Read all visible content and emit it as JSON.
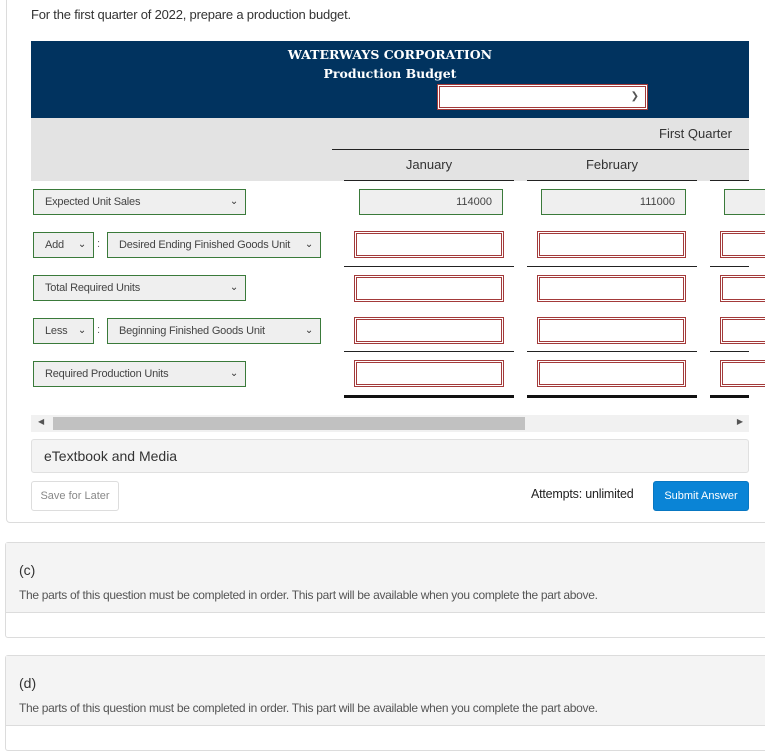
{
  "intro": "For the first quarter of 2022, prepare a production budget.",
  "budget": {
    "company": "WATERWAYS CORPORATION",
    "title": "Production Budget",
    "period_select": {
      "value": ""
    },
    "column_group": "First Quarter",
    "columns": [
      "January",
      "February"
    ]
  },
  "rows": [
    {
      "operator": null,
      "label": "Expected Unit Sales",
      "values": [
        "114000",
        "111000",
        ""
      ]
    },
    {
      "operator": "Add",
      "label": "Desired Ending Finished Goods Unit",
      "values": [
        "",
        "",
        ""
      ]
    },
    {
      "operator": null,
      "label": "Total Required Units",
      "values": [
        "",
        "",
        ""
      ]
    },
    {
      "operator": "Less",
      "label": "Beginning Finished Goods Unit",
      "values": [
        "",
        "",
        ""
      ]
    },
    {
      "operator": null,
      "label": "Required Production Units",
      "values": [
        "",
        "",
        ""
      ]
    }
  ],
  "separator": ":",
  "etextbook": "eTextbook and Media",
  "save_label": "Save for Later",
  "attempts": "Attempts: unlimited",
  "submit_label": "Submit Answer",
  "parts": [
    {
      "label": "(c)",
      "message": "The parts of this question must be completed in order. This part will be available when you complete the part above."
    },
    {
      "label": "(d)",
      "message": "The parts of this question must be completed in order. This part will be available when you complete the part above."
    }
  ],
  "colors": {
    "header_navy": "#01335f",
    "accent_blue": "#0a84d6",
    "valid_green": "#3a7a3a",
    "error_red": "#a33a3a"
  }
}
